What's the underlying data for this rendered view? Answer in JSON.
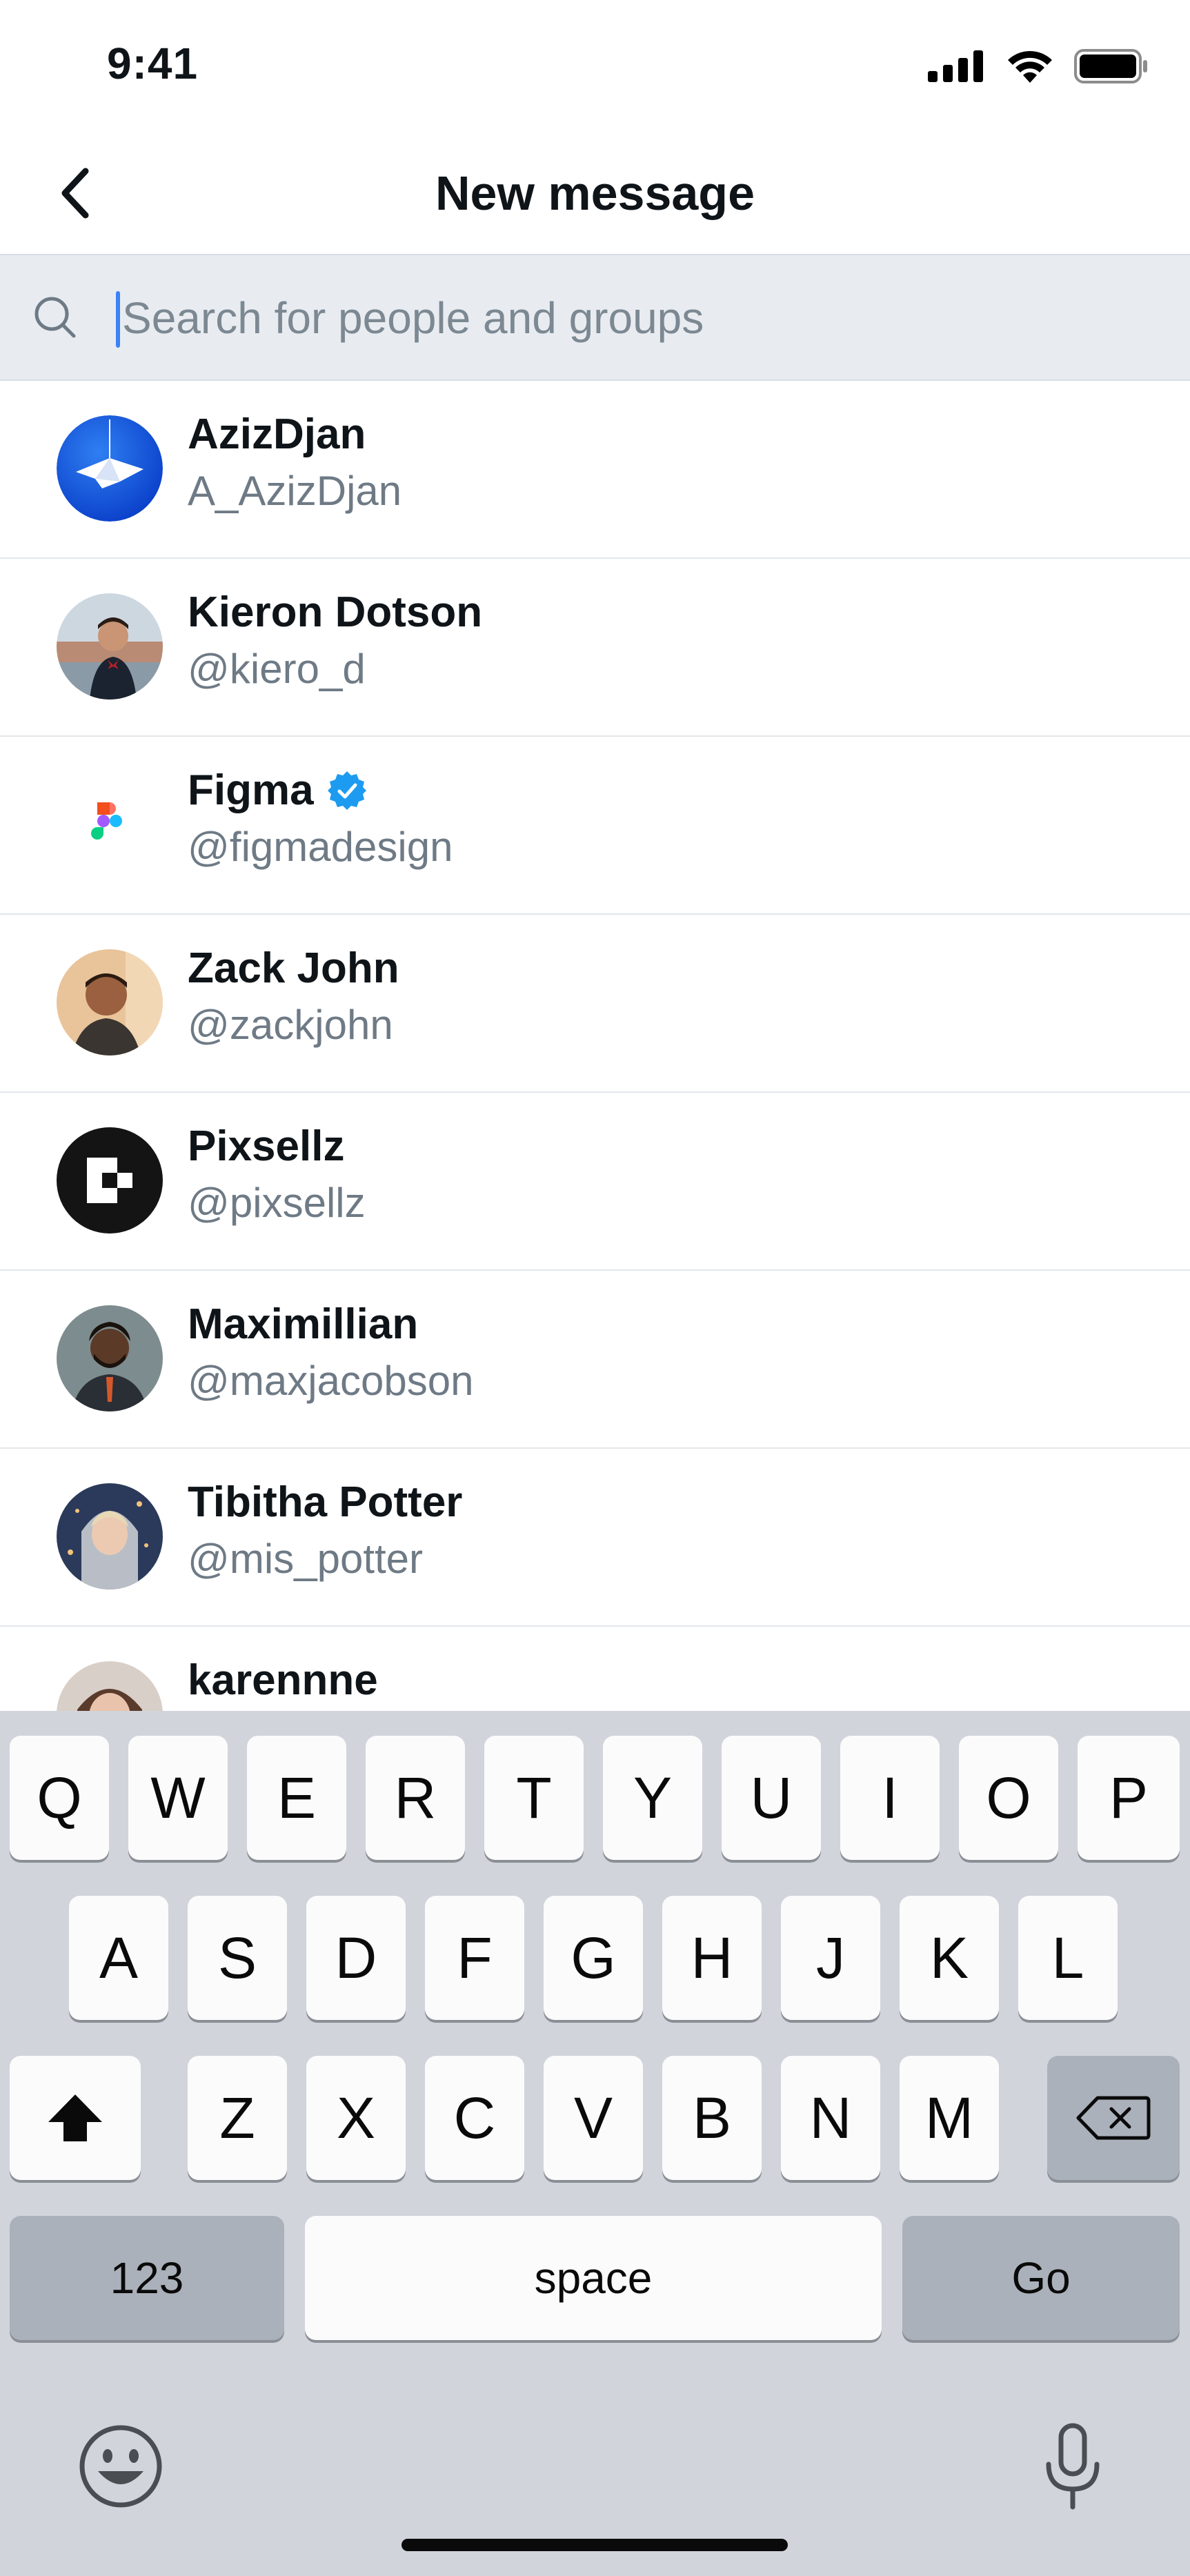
{
  "status_bar": {
    "time": "9:41"
  },
  "header": {
    "title": "New message"
  },
  "search": {
    "placeholder": "Search for people and groups",
    "value": ""
  },
  "contacts": [
    {
      "name": "AzizDjan",
      "handle": "A_AzizDjan",
      "verified": false
    },
    {
      "name": "Kieron Dotson",
      "handle": "@kiero_d",
      "verified": false
    },
    {
      "name": "Figma",
      "handle": "@figmadesign",
      "verified": true
    },
    {
      "name": "Zack John",
      "handle": "@zackjohn",
      "verified": false
    },
    {
      "name": "Pixsellz",
      "handle": "@pixsellz",
      "verified": false
    },
    {
      "name": "Maximillian",
      "handle": "@maxjacobson",
      "verified": false
    },
    {
      "name": "Tibitha Potter",
      "handle": "@mis_potter",
      "verified": false
    },
    {
      "name": "karennne",
      "handle": "",
      "verified": false
    }
  ],
  "keyboard": {
    "row1": [
      "Q",
      "W",
      "E",
      "R",
      "T",
      "Y",
      "U",
      "I",
      "O",
      "P"
    ],
    "row2": [
      "A",
      "S",
      "D",
      "F",
      "G",
      "H",
      "J",
      "K",
      "L"
    ],
    "row3": [
      "Z",
      "X",
      "C",
      "V",
      "B",
      "N",
      "M"
    ],
    "numbers_label": "123",
    "space_label": "space",
    "go_label": "Go"
  },
  "colors": {
    "accent": "#1d9bf0",
    "caret": "#3b82f6",
    "verified": "#1d9bf0"
  }
}
